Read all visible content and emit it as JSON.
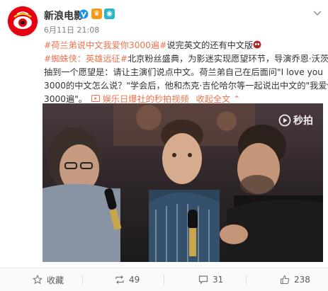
{
  "account": {
    "name": "新浪电影",
    "timestamp": "6月11日 21:08",
    "badge_vip": "V",
    "badge_lv": "@"
  },
  "post": {
    "line1_topic1": "#荷兰弟说中文我爱你3000遍#",
    "line1_rest": "说完英文的还有中文版",
    "line2_topic": "#蜘蛛侠：英雄远征#",
    "line2_rest": "北京粉丝盛典，为影迷实现愿望环节，导演乔恩·沃茨",
    "line3": "抽到一个愿望是：请让主演们说点中文。荷兰弟自己在后面问\"I love you",
    "line4": "3000的中文怎么说？\"学会后，他和杰克·吉伦哈尔等一起说出中文的\"我爱你",
    "line5_text": "3000遍\"。",
    "line5_link": "娱乐日爆社的秒拍视频",
    "expand_label": "收起全文"
  },
  "video": {
    "watermark": "秒拍"
  },
  "actions": {
    "favorite_label": "收藏",
    "repost_count": "49",
    "comment_count": "31",
    "like_count": "238"
  },
  "colors": {
    "accent": "#eb7350",
    "brand_red": "#e60012",
    "verified_blue": "#1a90e6"
  },
  "icons": [
    "sina-eye-logo",
    "verified-icon",
    "vip-badge-icon",
    "level-badge-icon",
    "chevron-down-icon",
    "play-link-icon",
    "miaopai-icon",
    "favorite-icon",
    "repost-icon",
    "comment-icon",
    "like-icon"
  ]
}
